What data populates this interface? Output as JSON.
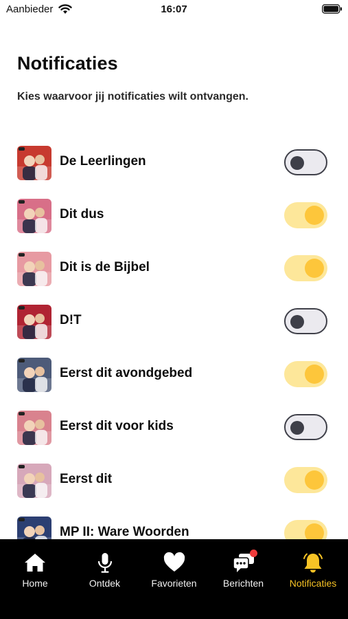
{
  "status_bar": {
    "carrier": "Aanbieder",
    "time": "16:07",
    "wifi_icon": "wifi-icon",
    "battery_icon": "battery-icon"
  },
  "header": {
    "title": "Notificaties",
    "subtitle": "Kies waarvoor jij notificaties wilt ontvangen."
  },
  "channels": [
    {
      "label": "De Leerlingen",
      "enabled": false,
      "thumb_color": "#c73a2f"
    },
    {
      "label": "Dit dus",
      "enabled": true,
      "thumb_color": "#d86f88"
    },
    {
      "label": "Dit is de Bijbel",
      "enabled": true,
      "thumb_color": "#e79aa2"
    },
    {
      "label": "D!T",
      "enabled": false,
      "thumb_color": "#b02433"
    },
    {
      "label": "Eerst dit avondgebed",
      "enabled": true,
      "thumb_color": "#4d5b79"
    },
    {
      "label": "Eerst dit voor kids",
      "enabled": false,
      "thumb_color": "#d9828e"
    },
    {
      "label": "Eerst dit",
      "enabled": true,
      "thumb_color": "#d7a8ba"
    },
    {
      "label": "MP II: Ware Woorden",
      "enabled": true,
      "thumb_color": "#2c3f72"
    }
  ],
  "colors": {
    "accent": "#f7c325",
    "toggle_on_track": "#fde79a",
    "toggle_on_knob": "#fdc63b",
    "toggle_off_track": "#ebeaef",
    "badge": "#ef3b3b"
  },
  "tabbar": {
    "tabs": [
      {
        "label": "Home",
        "icon": "home-icon",
        "active": false
      },
      {
        "label": "Ontdek",
        "icon": "microphone-icon",
        "active": false
      },
      {
        "label": "Favorieten",
        "icon": "heart-icon",
        "active": false
      },
      {
        "label": "Berichten",
        "icon": "messages-icon",
        "active": false,
        "badge": true
      },
      {
        "label": "Notificaties",
        "icon": "bell-icon",
        "active": true
      }
    ]
  }
}
